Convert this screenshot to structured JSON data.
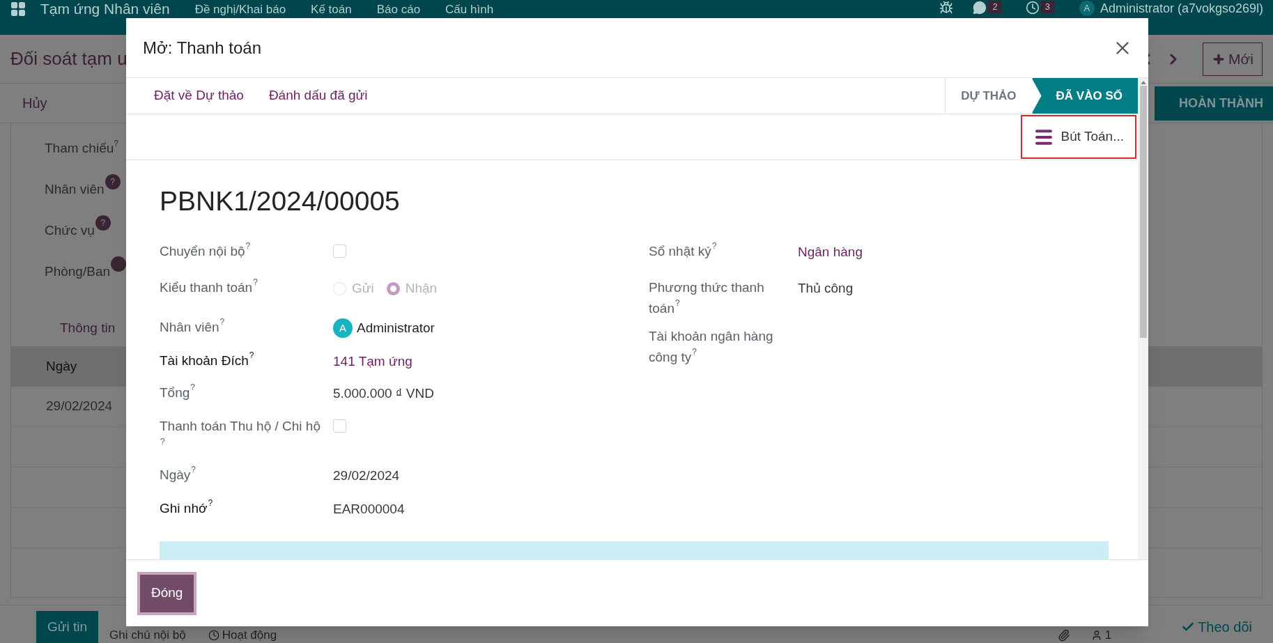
{
  "app_bar": {
    "title": "Tạm ứng Nhân viên",
    "menu": [
      "Đề nghị/Khai báo",
      "Kế toán",
      "Báo cáo",
      "Cấu hình"
    ],
    "chat_badge": "2",
    "activity_badge": "3",
    "avatar": "A",
    "user": "Administrator (a7vokgso269l)"
  },
  "background_form": {
    "title": "Đối soát tạm ư",
    "new_button": "Mới",
    "cancel_button": "Hủy",
    "status": "HOÀN THÀNH",
    "fields": [
      {
        "label": "Tham chiếu",
        "help": "?",
        "kind": "plain"
      },
      {
        "label": "Nhân viên",
        "help": "?",
        "kind": "badge"
      },
      {
        "label": "Chức vụ",
        "help": "?",
        "kind": "badge"
      },
      {
        "label": "Phòng/Ban",
        "kind": "badge"
      }
    ],
    "tab": "Thông tin",
    "table": {
      "columns": [
        "Ngày"
      ],
      "rows": [
        [
          "29/02/2024"
        ]
      ]
    }
  },
  "chatter": {
    "send_button": "Gửi tin",
    "note_button": "Ghi chú nội bộ",
    "activity_button": "Hoạt động",
    "followers": "1",
    "follow_button": "Theo dõi"
  },
  "dialog": {
    "title": "Mở: Thanh toán",
    "actions": [
      "Đặt về Dự thảo",
      "Đánh dấu đã gửi"
    ],
    "stages": [
      {
        "label": "DỰ THẢO",
        "selected": false
      },
      {
        "label": "ĐÃ VÀO SỔ",
        "selected": true
      }
    ],
    "smart_button": {
      "label": "Bút Toán...",
      "highlighted": true
    },
    "record_name": "PBNK1/2024/00005",
    "left_fields": [
      {
        "kind": "checkbox",
        "label": "Chuyển nội bộ",
        "help": "?",
        "required": false,
        "checked": false
      },
      {
        "kind": "radio",
        "label": "Kiểu thanh toán",
        "help": "?",
        "required": false,
        "options": [
          {
            "label": "Gửi",
            "selected": false
          },
          {
            "label": "Nhận",
            "selected": true
          }
        ]
      },
      {
        "kind": "avatar",
        "label": "Nhân viên",
        "help": "?",
        "required": false,
        "avatar": "A",
        "value": "Administrator"
      },
      {
        "kind": "link",
        "label": "Tài khoản Đích",
        "help": "?",
        "required": true,
        "value": "141 Tạm ứng"
      },
      {
        "kind": "text",
        "label": "Tổng",
        "help": "?",
        "required": false,
        "value": "5.000.000 ₫ VND"
      },
      {
        "kind": "checkbox",
        "label": "Thanh toán Thu hộ / Chi hộ",
        "help": "?",
        "required": false,
        "checked": false
      },
      {
        "kind": "text",
        "label": "Ngày",
        "help": "?",
        "required": false,
        "value": "29/02/2024"
      },
      {
        "kind": "text",
        "label": "Ghi nhớ",
        "help": "?",
        "required": true,
        "value": "EAR000004"
      }
    ],
    "right_fields": [
      {
        "kind": "link",
        "label": "Sổ nhật ký",
        "help": "?",
        "required": false,
        "value": "Ngân hàng"
      },
      {
        "kind": "text",
        "label": "Phương thức thanh toán",
        "help": "?",
        "required": false,
        "value": "Thủ công"
      },
      {
        "kind": "empty",
        "label": "Tài khoản ngân hàng công ty",
        "help": "?",
        "required": false
      }
    ],
    "close_button": "Đóng"
  }
}
